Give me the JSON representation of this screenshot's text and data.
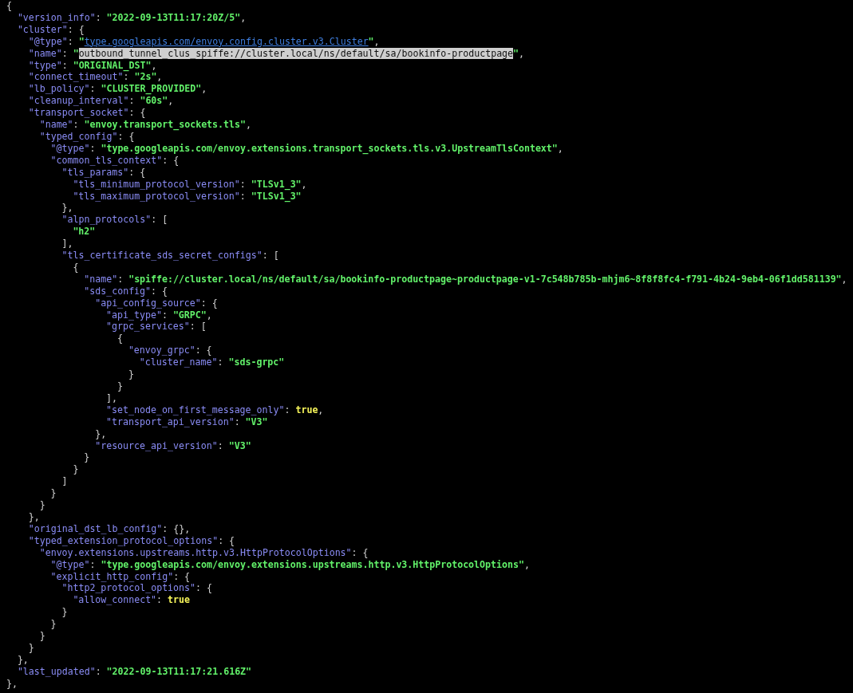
{
  "terminal": {
    "lines": [
      {
        "tokens": [
          {
            "kind": "punct",
            "text": "{"
          }
        ],
        "children": [
          {
            "tokens": [
              {
                "kind": "key",
                "text": "\"version_info\""
              },
              {
                "kind": "punct",
                "text": ": "
              },
              {
                "kind": "str",
                "text": "\"2022-09-13T11:17:20Z/5\""
              },
              {
                "kind": "punct",
                "text": ","
              }
            ]
          },
          {
            "tokens": [
              {
                "kind": "key",
                "text": "\"cluster\""
              },
              {
                "kind": "punct",
                "text": ": {"
              }
            ],
            "children": [
              {
                "tokens": [
                  {
                    "kind": "key",
                    "text": "\"@type\""
                  },
                  {
                    "kind": "punct",
                    "text": ": "
                  },
                  {
                    "kind": "str",
                    "text": "\""
                  },
                  {
                    "kind": "link",
                    "text": "type.googleapis.com/envoy.config.cluster.v3.Cluster"
                  },
                  {
                    "kind": "str",
                    "text": "\""
                  },
                  {
                    "kind": "punct",
                    "text": ","
                  }
                ]
              },
              {
                "tokens": [
                  {
                    "kind": "key",
                    "text": "\"name\""
                  },
                  {
                    "kind": "punct",
                    "text": ": "
                  },
                  {
                    "kind": "str",
                    "text": "\""
                  },
                  {
                    "kind": "selection",
                    "text": "outbound_tunnel_clus_spiffe://cluster.local/ns/default/sa/bookinfo-productpage"
                  },
                  {
                    "kind": "str",
                    "text": "\""
                  },
                  {
                    "kind": "punct",
                    "text": ","
                  }
                ]
              },
              {
                "tokens": [
                  {
                    "kind": "key",
                    "text": "\"type\""
                  },
                  {
                    "kind": "punct",
                    "text": ": "
                  },
                  {
                    "kind": "str",
                    "text": "\"ORIGINAL_DST\""
                  },
                  {
                    "kind": "punct",
                    "text": ","
                  }
                ]
              },
              {
                "tokens": [
                  {
                    "kind": "key",
                    "text": "\"connect_timeout\""
                  },
                  {
                    "kind": "punct",
                    "text": ": "
                  },
                  {
                    "kind": "str",
                    "text": "\"2s\""
                  },
                  {
                    "kind": "punct",
                    "text": ","
                  }
                ]
              },
              {
                "tokens": [
                  {
                    "kind": "key",
                    "text": "\"lb_policy\""
                  },
                  {
                    "kind": "punct",
                    "text": ": "
                  },
                  {
                    "kind": "str",
                    "text": "\"CLUSTER_PROVIDED\""
                  },
                  {
                    "kind": "punct",
                    "text": ","
                  }
                ]
              },
              {
                "tokens": [
                  {
                    "kind": "key",
                    "text": "\"cleanup_interval\""
                  },
                  {
                    "kind": "punct",
                    "text": ": "
                  },
                  {
                    "kind": "str",
                    "text": "\"60s\""
                  },
                  {
                    "kind": "punct",
                    "text": ","
                  }
                ]
              },
              {
                "tokens": [
                  {
                    "kind": "key",
                    "text": "\"transport_socket\""
                  },
                  {
                    "kind": "punct",
                    "text": ": {"
                  }
                ],
                "children": [
                  {
                    "tokens": [
                      {
                        "kind": "key",
                        "text": "\"name\""
                      },
                      {
                        "kind": "punct",
                        "text": ": "
                      },
                      {
                        "kind": "str",
                        "text": "\"envoy.transport_sockets.tls\""
                      },
                      {
                        "kind": "punct",
                        "text": ","
                      }
                    ]
                  },
                  {
                    "tokens": [
                      {
                        "kind": "key",
                        "text": "\"typed_config\""
                      },
                      {
                        "kind": "punct",
                        "text": ": {"
                      }
                    ],
                    "children": [
                      {
                        "tokens": [
                          {
                            "kind": "key",
                            "text": "\"@type\""
                          },
                          {
                            "kind": "punct",
                            "text": ": "
                          },
                          {
                            "kind": "str",
                            "text": "\"type.googleapis.com/envoy.extensions.transport_sockets.tls.v3.UpstreamTlsContext\""
                          },
                          {
                            "kind": "punct",
                            "text": ","
                          }
                        ]
                      },
                      {
                        "tokens": [
                          {
                            "kind": "key",
                            "text": "\"common_tls_context\""
                          },
                          {
                            "kind": "punct",
                            "text": ": {"
                          }
                        ],
                        "children": [
                          {
                            "tokens": [
                              {
                                "kind": "key",
                                "text": "\"tls_params\""
                              },
                              {
                                "kind": "punct",
                                "text": ": {"
                              }
                            ],
                            "children": [
                              {
                                "tokens": [
                                  {
                                    "kind": "key",
                                    "text": "\"tls_minimum_protocol_version\""
                                  },
                                  {
                                    "kind": "punct",
                                    "text": ": "
                                  },
                                  {
                                    "kind": "str",
                                    "text": "\"TLSv1_3\""
                                  },
                                  {
                                    "kind": "punct",
                                    "text": ","
                                  }
                                ]
                              },
                              {
                                "tokens": [
                                  {
                                    "kind": "key",
                                    "text": "\"tls_maximum_protocol_version\""
                                  },
                                  {
                                    "kind": "punct",
                                    "text": ": "
                                  },
                                  {
                                    "kind": "str",
                                    "text": "\"TLSv1_3\""
                                  }
                                ]
                              }
                            ]
                          },
                          {
                            "tokens": [
                              {
                                "kind": "punct",
                                "text": "},"
                              }
                            ]
                          },
                          {
                            "tokens": [
                              {
                                "kind": "key",
                                "text": "\"alpn_protocols\""
                              },
                              {
                                "kind": "punct",
                                "text": ": ["
                              }
                            ],
                            "children": [
                              {
                                "tokens": [
                                  {
                                    "kind": "str",
                                    "text": "\"h2\""
                                  }
                                ]
                              }
                            ]
                          },
                          {
                            "tokens": [
                              {
                                "kind": "punct",
                                "text": "],"
                              }
                            ]
                          },
                          {
                            "tokens": [
                              {
                                "kind": "key",
                                "text": "\"tls_certificate_sds_secret_configs\""
                              },
                              {
                                "kind": "punct",
                                "text": ": ["
                              }
                            ],
                            "children": [
                              {
                                "tokens": [
                                  {
                                    "kind": "punct",
                                    "text": "{"
                                  }
                                ],
                                "children": [
                                  {
                                    "tokens": [
                                      {
                                        "kind": "key",
                                        "text": "\"name\""
                                      },
                                      {
                                        "kind": "punct",
                                        "text": ": "
                                      },
                                      {
                                        "kind": "str",
                                        "text": "\"spiffe://cluster.local/ns/default/sa/bookinfo-productpage~productpage-v1-7c548b785b-mhjm6~8f8f8fc4-f791-4b24-9eb4-06f1dd581139\""
                                      },
                                      {
                                        "kind": "punct",
                                        "text": ","
                                      }
                                    ]
                                  },
                                  {
                                    "tokens": [
                                      {
                                        "kind": "key",
                                        "text": "\"sds_config\""
                                      },
                                      {
                                        "kind": "punct",
                                        "text": ": {"
                                      }
                                    ],
                                    "children": [
                                      {
                                        "tokens": [
                                          {
                                            "kind": "key",
                                            "text": "\"api_config_source\""
                                          },
                                          {
                                            "kind": "punct",
                                            "text": ": {"
                                          }
                                        ],
                                        "children": [
                                          {
                                            "tokens": [
                                              {
                                                "kind": "key",
                                                "text": "\"api_type\""
                                              },
                                              {
                                                "kind": "punct",
                                                "text": ": "
                                              },
                                              {
                                                "kind": "str",
                                                "text": "\"GRPC\""
                                              },
                                              {
                                                "kind": "punct",
                                                "text": ","
                                              }
                                            ]
                                          },
                                          {
                                            "tokens": [
                                              {
                                                "kind": "key",
                                                "text": "\"grpc_services\""
                                              },
                                              {
                                                "kind": "punct",
                                                "text": ": ["
                                              }
                                            ],
                                            "children": [
                                              {
                                                "tokens": [
                                                  {
                                                    "kind": "punct",
                                                    "text": "{"
                                                  }
                                                ],
                                                "children": [
                                                  {
                                                    "tokens": [
                                                      {
                                                        "kind": "key",
                                                        "text": "\"envoy_grpc\""
                                                      },
                                                      {
                                                        "kind": "punct",
                                                        "text": ": {"
                                                      }
                                                    ],
                                                    "children": [
                                                      {
                                                        "tokens": [
                                                          {
                                                            "kind": "key",
                                                            "text": "\"cluster_name\""
                                                          },
                                                          {
                                                            "kind": "punct",
                                                            "text": ": "
                                                          },
                                                          {
                                                            "kind": "str",
                                                            "text": "\"sds-grpc\""
                                                          }
                                                        ]
                                                      }
                                                    ]
                                                  },
                                                  {
                                                    "tokens": [
                                                      {
                                                        "kind": "punct",
                                                        "text": "}"
                                                      }
                                                    ]
                                                  }
                                                ]
                                              },
                                              {
                                                "tokens": [
                                                  {
                                                    "kind": "punct",
                                                    "text": "}"
                                                  }
                                                ]
                                              }
                                            ]
                                          },
                                          {
                                            "tokens": [
                                              {
                                                "kind": "punct",
                                                "text": "],"
                                              }
                                            ]
                                          },
                                          {
                                            "tokens": [
                                              {
                                                "kind": "key",
                                                "text": "\"set_node_on_first_message_only\""
                                              },
                                              {
                                                "kind": "punct",
                                                "text": ": "
                                              },
                                              {
                                                "kind": "bool",
                                                "text": "true"
                                              },
                                              {
                                                "kind": "punct",
                                                "text": ","
                                              }
                                            ]
                                          },
                                          {
                                            "tokens": [
                                              {
                                                "kind": "key",
                                                "text": "\"transport_api_version\""
                                              },
                                              {
                                                "kind": "punct",
                                                "text": ": "
                                              },
                                              {
                                                "kind": "str",
                                                "text": "\"V3\""
                                              }
                                            ]
                                          }
                                        ]
                                      },
                                      {
                                        "tokens": [
                                          {
                                            "kind": "punct",
                                            "text": "},"
                                          }
                                        ]
                                      },
                                      {
                                        "tokens": [
                                          {
                                            "kind": "key",
                                            "text": "\"resource_api_version\""
                                          },
                                          {
                                            "kind": "punct",
                                            "text": ": "
                                          },
                                          {
                                            "kind": "str",
                                            "text": "\"V3\""
                                          }
                                        ]
                                      }
                                    ]
                                  },
                                  {
                                    "tokens": [
                                      {
                                        "kind": "punct",
                                        "text": "}"
                                      }
                                    ]
                                  }
                                ]
                              },
                              {
                                "tokens": [
                                  {
                                    "kind": "punct",
                                    "text": "}"
                                  }
                                ]
                              }
                            ]
                          },
                          {
                            "tokens": [
                              {
                                "kind": "punct",
                                "text": "]"
                              }
                            ]
                          }
                        ]
                      },
                      {
                        "tokens": [
                          {
                            "kind": "punct",
                            "text": "}"
                          }
                        ]
                      }
                    ]
                  },
                  {
                    "tokens": [
                      {
                        "kind": "punct",
                        "text": "}"
                      }
                    ]
                  }
                ]
              },
              {
                "tokens": [
                  {
                    "kind": "punct",
                    "text": "},"
                  }
                ]
              },
              {
                "tokens": [
                  {
                    "kind": "key",
                    "text": "\"original_dst_lb_config\""
                  },
                  {
                    "kind": "punct",
                    "text": ": {},"
                  }
                ]
              },
              {
                "tokens": [
                  {
                    "kind": "key",
                    "text": "\"typed_extension_protocol_options\""
                  },
                  {
                    "kind": "punct",
                    "text": ": {"
                  }
                ],
                "children": [
                  {
                    "tokens": [
                      {
                        "kind": "key",
                        "text": "\"envoy.extensions.upstreams.http.v3.HttpProtocolOptions\""
                      },
                      {
                        "kind": "punct",
                        "text": ": {"
                      }
                    ],
                    "children": [
                      {
                        "tokens": [
                          {
                            "kind": "key",
                            "text": "\"@type\""
                          },
                          {
                            "kind": "punct",
                            "text": ": "
                          },
                          {
                            "kind": "str",
                            "text": "\"type.googleapis.com/envoy.extensions.upstreams.http.v3.HttpProtocolOptions\""
                          },
                          {
                            "kind": "punct",
                            "text": ","
                          }
                        ]
                      },
                      {
                        "tokens": [
                          {
                            "kind": "key",
                            "text": "\"explicit_http_config\""
                          },
                          {
                            "kind": "punct",
                            "text": ": {"
                          }
                        ],
                        "children": [
                          {
                            "tokens": [
                              {
                                "kind": "key",
                                "text": "\"http2_protocol_options\""
                              },
                              {
                                "kind": "punct",
                                "text": ": {"
                              }
                            ],
                            "children": [
                              {
                                "tokens": [
                                  {
                                    "kind": "key",
                                    "text": "\"allow_connect\""
                                  },
                                  {
                                    "kind": "punct",
                                    "text": ": "
                                  },
                                  {
                                    "kind": "bool",
                                    "text": "true"
                                  }
                                ]
                              }
                            ]
                          },
                          {
                            "tokens": [
                              {
                                "kind": "punct",
                                "text": "}"
                              }
                            ]
                          }
                        ]
                      },
                      {
                        "tokens": [
                          {
                            "kind": "punct",
                            "text": "}"
                          }
                        ]
                      }
                    ]
                  },
                  {
                    "tokens": [
                      {
                        "kind": "punct",
                        "text": "}"
                      }
                    ]
                  }
                ]
              },
              {
                "tokens": [
                  {
                    "kind": "punct",
                    "text": "}"
                  }
                ]
              }
            ]
          },
          {
            "tokens": [
              {
                "kind": "punct",
                "text": "},"
              }
            ]
          },
          {
            "tokens": [
              {
                "kind": "key",
                "text": "\"last_updated\""
              },
              {
                "kind": "punct",
                "text": ": "
              },
              {
                "kind": "str",
                "text": "\"2022-09-13T11:17:21.616Z\""
              }
            ]
          }
        ]
      },
      {
        "tokens": [
          {
            "kind": "punct",
            "text": "},"
          }
        ]
      }
    ]
  }
}
